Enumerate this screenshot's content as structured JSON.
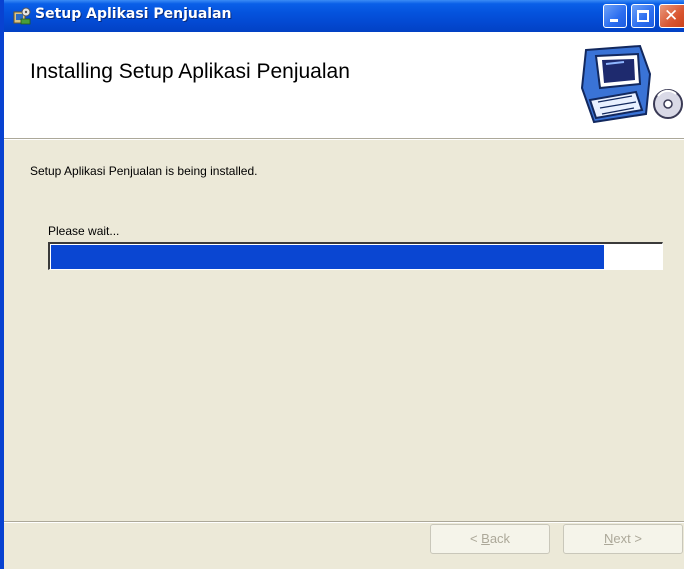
{
  "window": {
    "title": "Setup Aplikasi Penjualan"
  },
  "header": {
    "title": "Installing Setup Aplikasi Penjualan",
    "art_icon": "computer-cd-icon"
  },
  "main": {
    "status_text": "Setup Aplikasi Penjualan is being installed.",
    "wait_text": "Please wait...",
    "progress_fraction": 0.906
  },
  "buttons": {
    "back_prefix": "< ",
    "back_key": "B",
    "back_rest": "ack",
    "next_key": "N",
    "next_rest": "ext >"
  },
  "colors": {
    "title_bar": "#0453dd",
    "progress_fill": "#0a46d2",
    "close_button": "#d9542f",
    "dialog_background": "#ece9d8"
  }
}
